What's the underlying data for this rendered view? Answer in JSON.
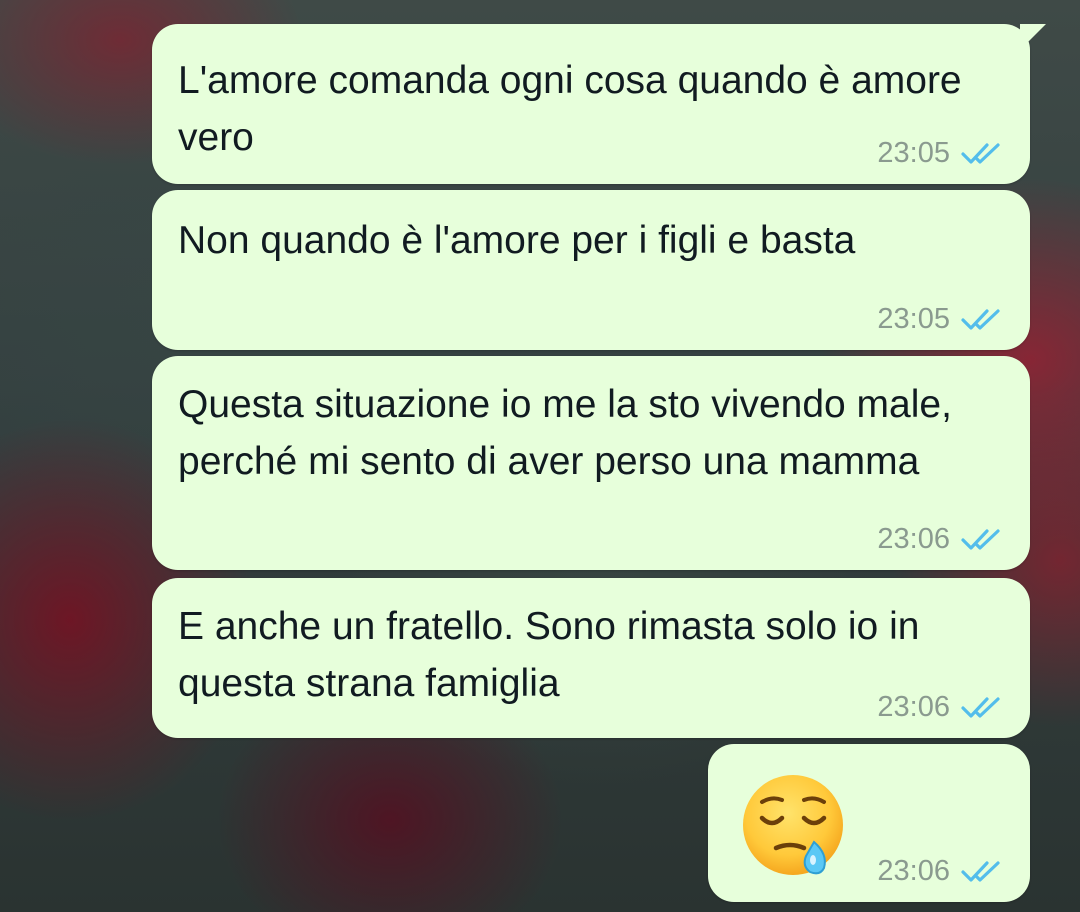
{
  "messages": [
    {
      "text": "L'amore comanda ogni cosa quando è amore vero",
      "time": "23:05",
      "status_icon": "double-check-read-icon"
    },
    {
      "text": "Non quando è l'amore per i figli e basta",
      "time": "23:05",
      "status_icon": "double-check-read-icon"
    },
    {
      "text": "Questa situazione io me la sto vivendo male, perché mi sento di aver perso una mamma",
      "time": "23:06",
      "status_icon": "double-check-read-icon"
    },
    {
      "text": "E anche un fratello. Sono rimasta solo io in questa strana famiglia",
      "time": "23:06",
      "status_icon": "double-check-read-icon"
    },
    {
      "emoji": "sleepy-face-emoji",
      "time": "23:06",
      "status_icon": "double-check-read-icon"
    }
  ],
  "colors": {
    "bubble": "#e7ffdb",
    "text": "#111b21",
    "time": "#8a9a8f",
    "read_tick": "#53bdeb"
  }
}
